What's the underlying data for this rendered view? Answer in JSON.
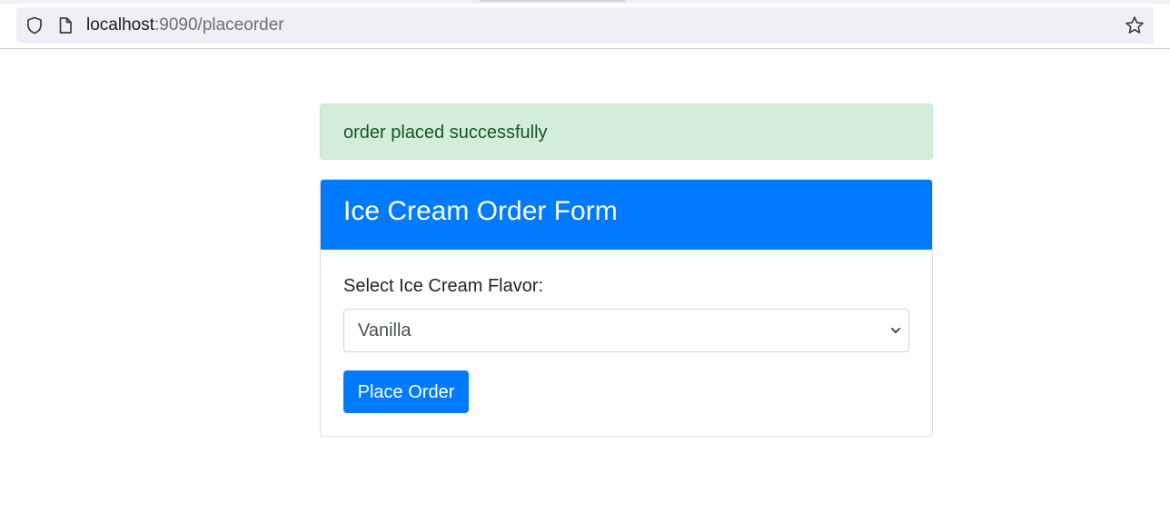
{
  "browser": {
    "url_host": "localhost",
    "url_path": ":9090/placeorder",
    "icons": [
      "shield-icon",
      "page-icon",
      "bookmark-star-icon"
    ]
  },
  "alert": {
    "message": "order placed successfully",
    "color": "#155724",
    "background": "#d4edda"
  },
  "form": {
    "title": "Ice Cream Order Form",
    "flavor_label": "Select Ice Cream Flavor:",
    "flavor_selected": "Vanilla",
    "submit_label": "Place Order",
    "accent_color": "#007bff"
  }
}
